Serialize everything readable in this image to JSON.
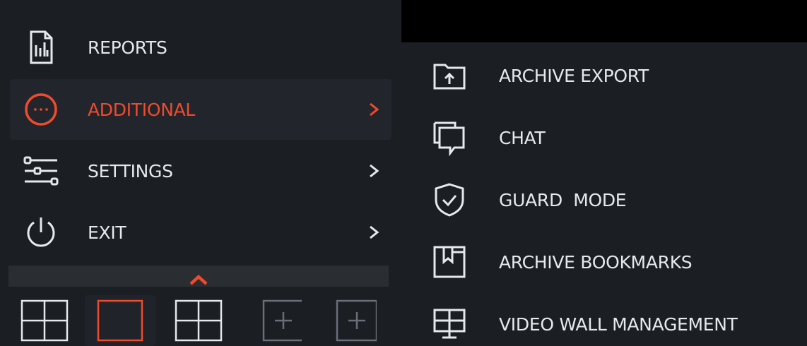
{
  "main_menu": {
    "items": [
      {
        "label": "REPORTS",
        "icon": "reports-icon",
        "has_arrow": false,
        "active": false
      },
      {
        "label": "ADDITIONAL",
        "icon": "more-circle-icon",
        "has_arrow": true,
        "active": true
      },
      {
        "label": "SETTINGS",
        "icon": "sliders-icon",
        "has_arrow": true,
        "active": false
      },
      {
        "label": "EXIT",
        "icon": "power-icon",
        "has_arrow": true,
        "active": false
      }
    ],
    "collapse_icon": "chevron-up-icon"
  },
  "layout_bar": {
    "buttons": [
      {
        "icon": "grid-2x2-icon",
        "selected": false
      },
      {
        "icon": "single-view-icon",
        "selected": true
      },
      {
        "icon": "grid-2x2-icon",
        "selected": false
      },
      {
        "icon": "add-layout-icon",
        "selected": false
      },
      {
        "icon": "add-layout-icon",
        "selected": false
      }
    ]
  },
  "submenu": {
    "items": [
      {
        "label": "ARCHIVE EXPORT",
        "icon": "folder-upload-icon"
      },
      {
        "label": "CHAT",
        "icon": "chat-icon"
      },
      {
        "label": "GUARD  MODE",
        "icon": "shield-check-icon"
      },
      {
        "label": "ARCHIVE BOOKMARKS",
        "icon": "bookmark-icon"
      },
      {
        "label": "VIDEO WALL MANAGEMENT",
        "icon": "video-wall-icon"
      }
    ]
  },
  "colors": {
    "accent": "#f04a2c",
    "text": "#e6e8ec",
    "background": "#1b1e23",
    "active_background": "#22262c",
    "topbar": "#000000"
  }
}
